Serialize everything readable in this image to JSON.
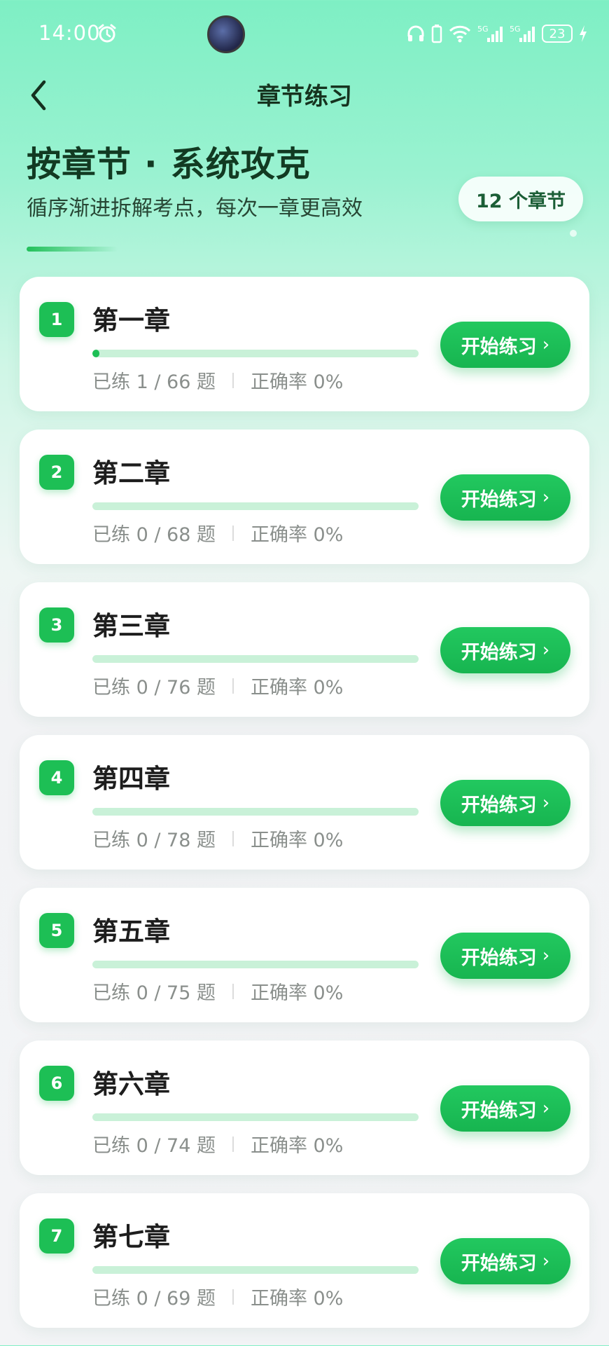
{
  "status_bar": {
    "time": "14:00",
    "battery_level": "23",
    "network_labels": [
      "5G",
      "5G"
    ]
  },
  "header": {
    "title": "章节练习"
  },
  "hero": {
    "title": "按章节 · 系统攻克",
    "subtitle": "循序渐进拆解考点，每次一章更高效",
    "chapter_count": "12 个章节"
  },
  "colors": {
    "accent": "#1DBF55",
    "track": "#C9F1D8"
  },
  "chapters": [
    {
      "number": "1",
      "name": "第一章",
      "progress_text": "已练 1 / 66 题",
      "accuracy_text": "正确率 0%",
      "done": 1,
      "total": 66,
      "button_label": "开始练习"
    },
    {
      "number": "2",
      "name": "第二章",
      "progress_text": "已练 0 / 68 题",
      "accuracy_text": "正确率 0%",
      "done": 0,
      "total": 68,
      "button_label": "开始练习"
    },
    {
      "number": "3",
      "name": "第三章",
      "progress_text": "已练 0 / 76 题",
      "accuracy_text": "正确率 0%",
      "done": 0,
      "total": 76,
      "button_label": "开始练习"
    },
    {
      "number": "4",
      "name": "第四章",
      "progress_text": "已练 0 / 78 题",
      "accuracy_text": "正确率 0%",
      "done": 0,
      "total": 78,
      "button_label": "开始练习"
    },
    {
      "number": "5",
      "name": "第五章",
      "progress_text": "已练 0 / 75 题",
      "accuracy_text": "正确率 0%",
      "done": 0,
      "total": 75,
      "button_label": "开始练习"
    },
    {
      "number": "6",
      "name": "第六章",
      "progress_text": "已练 0 / 74 题",
      "accuracy_text": "正确率 0%",
      "done": 0,
      "total": 74,
      "button_label": "开始练习"
    },
    {
      "number": "7",
      "name": "第七章",
      "progress_text": "已练 0 / 69 题",
      "accuracy_text": "正确率 0%",
      "done": 0,
      "total": 69,
      "button_label": "开始练习"
    }
  ]
}
